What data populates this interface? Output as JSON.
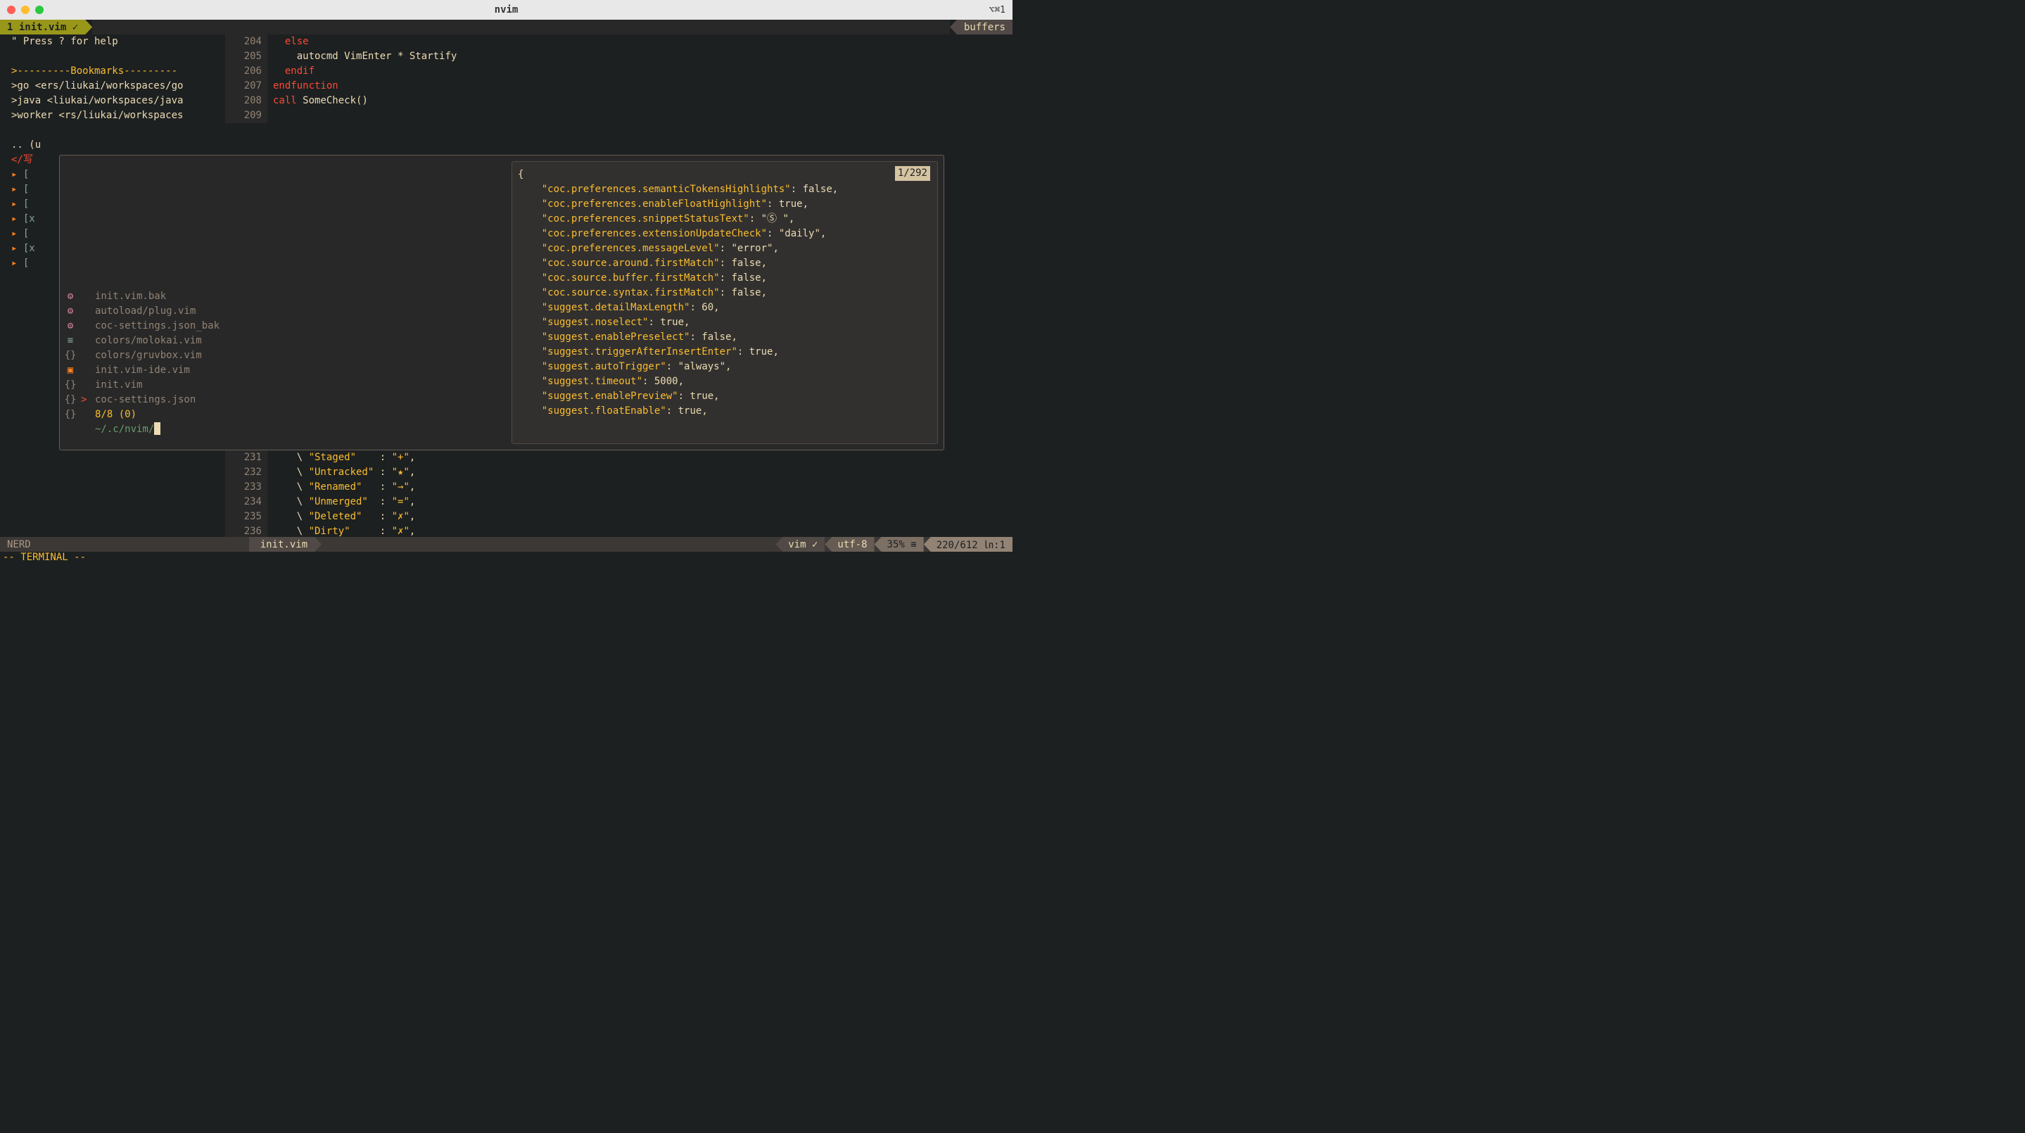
{
  "titlebar": {
    "title": "nvim",
    "shortcut": "⌥⌘1"
  },
  "tabline": {
    "active": "1 init.vim ✓",
    "buffers_label": "buffers"
  },
  "sidebar": {
    "help": "\" Press ? for help",
    "bookmarks_header": ">---------Bookmarks---------",
    "bookmarks": [
      ">go <ers/liukai/workspaces/go",
      ">java <liukai/workspaces/java",
      ">worker <rs/liukai/workspaces"
    ],
    "tree": {
      "l1": ".. (u",
      "l2": "</写",
      "collapsed": [
        "[",
        "[",
        "[",
        "[x",
        "[",
        "[x",
        "["
      ]
    }
  },
  "code_top": [
    {
      "num": "204",
      "text": "  else",
      "cls": "red"
    },
    {
      "num": "205",
      "text": "    autocmd ",
      "k": "red",
      "rest": "VimEnter * Startify",
      "restcls": "tan"
    },
    {
      "num": "206",
      "text": "  endif",
      "cls": "red"
    },
    {
      "num": "207",
      "text": "endfunction",
      "cls": "red"
    },
    {
      "num": "208",
      "text": "",
      "cls": ""
    },
    {
      "num": "209",
      "text": "call ",
      "cls": "red",
      "rest": "SomeCheck()",
      "restcls": "tan"
    }
  ],
  "popup": {
    "files": [
      {
        "icon": "⚙",
        "name": "init.vim.bak",
        "iconcls": "gear-icon"
      },
      {
        "icon": "⚙",
        "name": "autoload/plug.vim",
        "iconcls": "gear-icon"
      },
      {
        "icon": "⚙",
        "name": "coc-settings.json_bak",
        "iconcls": "gear-icon"
      },
      {
        "icon": "≡",
        "name": "colors/molokai.vim",
        "iconcls": "list-icon"
      },
      {
        "icon": "{}",
        "name": "colors/gruvbox.vim",
        "iconcls": "brace-icon"
      },
      {
        "icon": "▣",
        "name": "init.vim-ide.vim",
        "iconcls": "term-icon"
      },
      {
        "icon": "{}",
        "name": "init.vim",
        "iconcls": "brace-icon"
      },
      {
        "icon": "{}",
        "name": "coc-settings.json",
        "iconcls": "brace-icon",
        "selected": true,
        "marker": ">"
      },
      {
        "icon": "{}",
        "name": "8/8 (0)",
        "iconcls": "brace-icon",
        "info": true
      }
    ],
    "prompt": "~/.c/nvim/",
    "preview_count": "1/292",
    "preview": [
      "{",
      "    \"coc.preferences.semanticTokensHighlights\": false,",
      "    \"coc.preferences.enableFloatHighlight\": true,",
      "    \"coc.preferences.snippetStatusText\": \"Ⓢ \",",
      "    \"coc.preferences.extensionUpdateCheck\": \"daily\",",
      "    \"coc.preferences.messageLevel\": \"error\",",
      "    \"coc.source.around.firstMatch\": false,",
      "    \"coc.source.buffer.firstMatch\": false,",
      "    \"coc.source.syntax.firstMatch\": false,",
      "    \"suggest.detailMaxLength\": 60,",
      "    \"suggest.noselect\": true,",
      "    \"suggest.enablePreselect\": false,",
      "    \"suggest.triggerAfterInsertEnter\": true,",
      "    \"suggest.autoTrigger\": \"always\",",
      "    \"suggest.timeout\": 5000,",
      "    \"suggest.enablePreview\": true,",
      "    \"suggest.floatEnable\": true,"
    ]
  },
  "code_bottom": [
    {
      "num": "231",
      "l": "    \\ ",
      "k": "\"Staged\"",
      "pad": "   ",
      "m": " : ",
      "v": "\"+\"",
      "t": ","
    },
    {
      "num": "232",
      "l": "    \\ ",
      "k": "\"Untracked\"",
      "pad": "",
      "m": " : ",
      "v": "\"★\"",
      "t": ","
    },
    {
      "num": "233",
      "l": "    \\ ",
      "k": "\"Renamed\"",
      "pad": "  ",
      "m": " : ",
      "v": "\"→\"",
      "t": ","
    },
    {
      "num": "234",
      "l": "    \\ ",
      "k": "\"Unmerged\"",
      "pad": " ",
      "m": " : ",
      "v": "\"=\"",
      "t": ","
    },
    {
      "num": "235",
      "l": "    \\ ",
      "k": "\"Deleted\"",
      "pad": "  ",
      "m": " : ",
      "v": "\"✗\"",
      "t": ","
    },
    {
      "num": "236",
      "l": "    \\ ",
      "k": "\"Dirty\"",
      "pad": "    ",
      "m": " : ",
      "v": "\"✗\"",
      "t": ","
    }
  ],
  "statusline": {
    "nerd": "NERD",
    "file": "init.vim",
    "filetype": "vim ✓",
    "encoding": "utf-8 ",
    "percent": "35% ≡",
    "position": "220/612 ㏑:1"
  },
  "modeline": "-- TERMINAL --"
}
